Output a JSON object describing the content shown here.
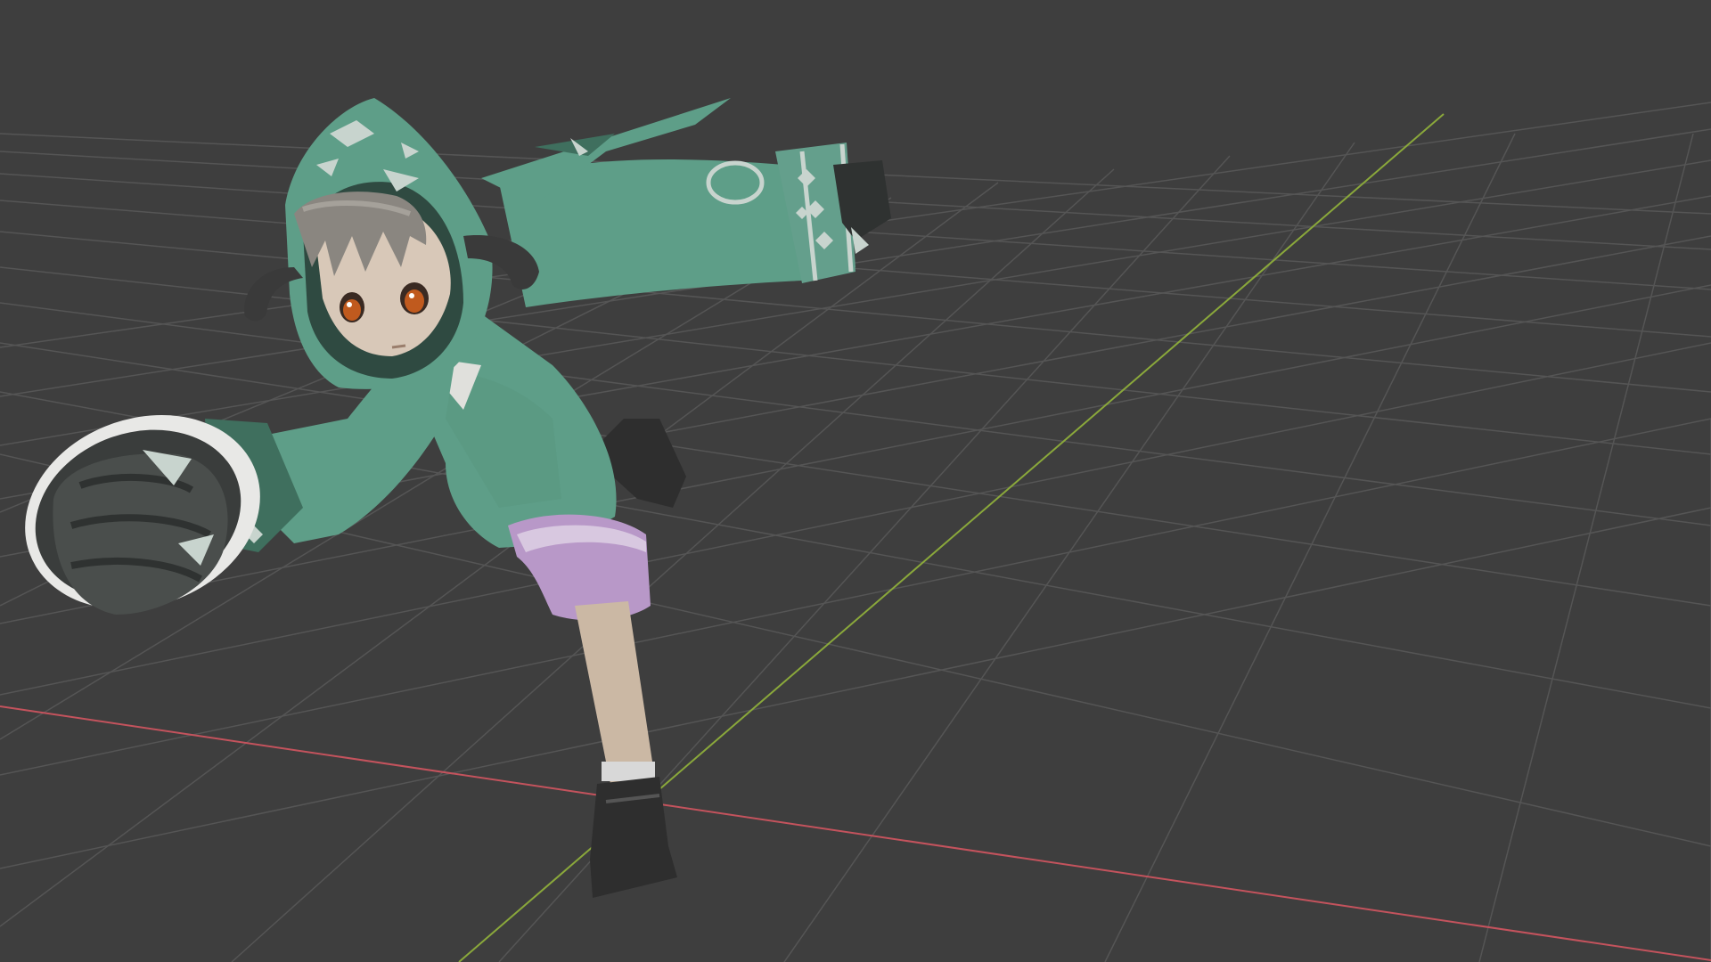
{
  "app": {
    "kind": "3D viewport (modeling application)",
    "view": "perspective"
  },
  "scene": {
    "background_color": "#3e3e3e",
    "grid_color": "#555555",
    "x_axis_color": "#c4535d",
    "y_axis_color": "#8aa83b",
    "model": {
      "icon": "character-model",
      "colors": {
        "hoodie": "#5e9e88",
        "hoodie_shadow": "#3f6f5e",
        "hoodie_pattern": "#c8d4ce",
        "skin": "#d8c8b8",
        "hair": "#8a8680",
        "horns": "#3a3a3a",
        "shorts": "#b898c8",
        "shoes": "#2e2e2e",
        "gloves": "#4a4e4c",
        "eyes": "#c05a1e"
      }
    }
  }
}
